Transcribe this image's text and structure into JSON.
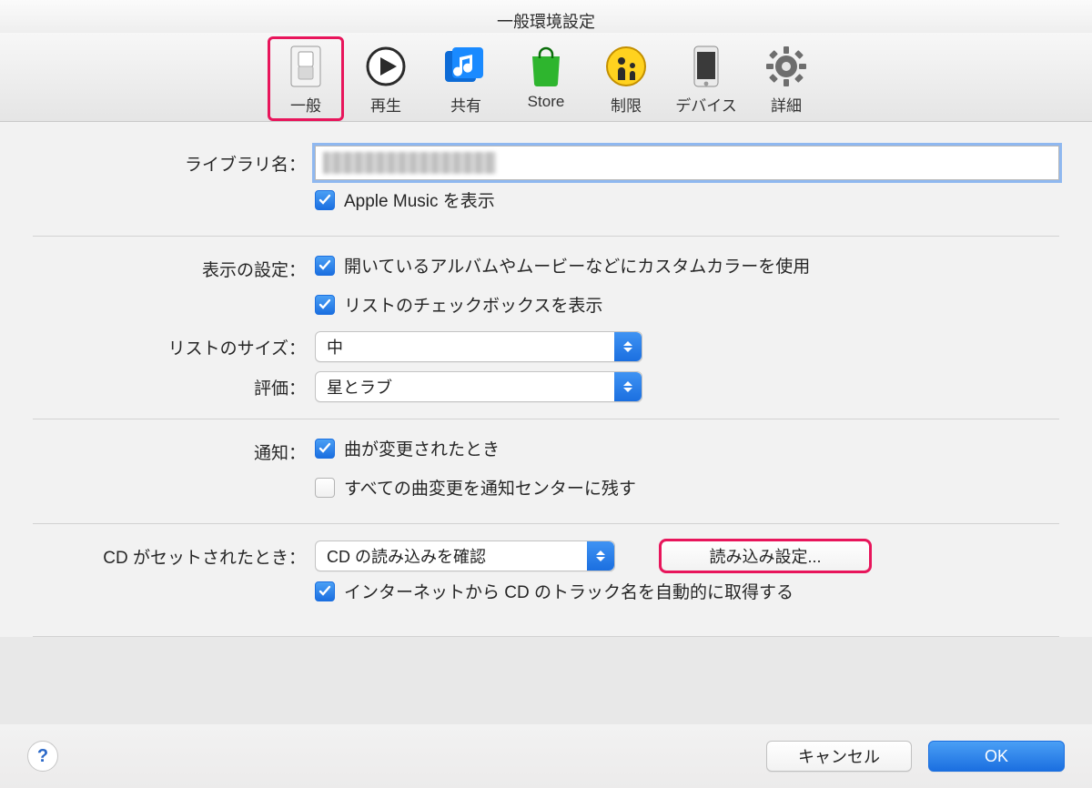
{
  "window_title": "一般環境設定",
  "toolbar": {
    "items": [
      {
        "label": "一般"
      },
      {
        "label": "再生"
      },
      {
        "label": "共有"
      },
      {
        "label": "Store"
      },
      {
        "label": "制限"
      },
      {
        "label": "デバイス"
      },
      {
        "label": "詳細"
      }
    ]
  },
  "form": {
    "library_name_label": "ライブラリ名：",
    "library_name_value": "",
    "apple_music_label": "Apple Music を表示",
    "display_settings_label": "表示の設定：",
    "custom_color_label": "開いているアルバムやムービーなどにカスタムカラーを使用",
    "list_checkbox_label": "リストのチェックボックスを表示",
    "list_size_label": "リストのサイズ：",
    "list_size_value": "中",
    "rating_label": "評価：",
    "rating_value": "星とラブ",
    "notification_label": "通知：",
    "notify_song_change_label": "曲が変更されたとき",
    "notify_all_changes_label": "すべての曲変更を通知センターに残す",
    "cd_insert_label": "CD がセットされたとき：",
    "cd_insert_value": "CD の読み込みを確認",
    "import_settings_button": "読み込み設定...",
    "auto_fetch_label": "インターネットから CD のトラック名を自動的に取得する"
  },
  "footer": {
    "cancel": "キャンセル",
    "ok": "OK"
  }
}
